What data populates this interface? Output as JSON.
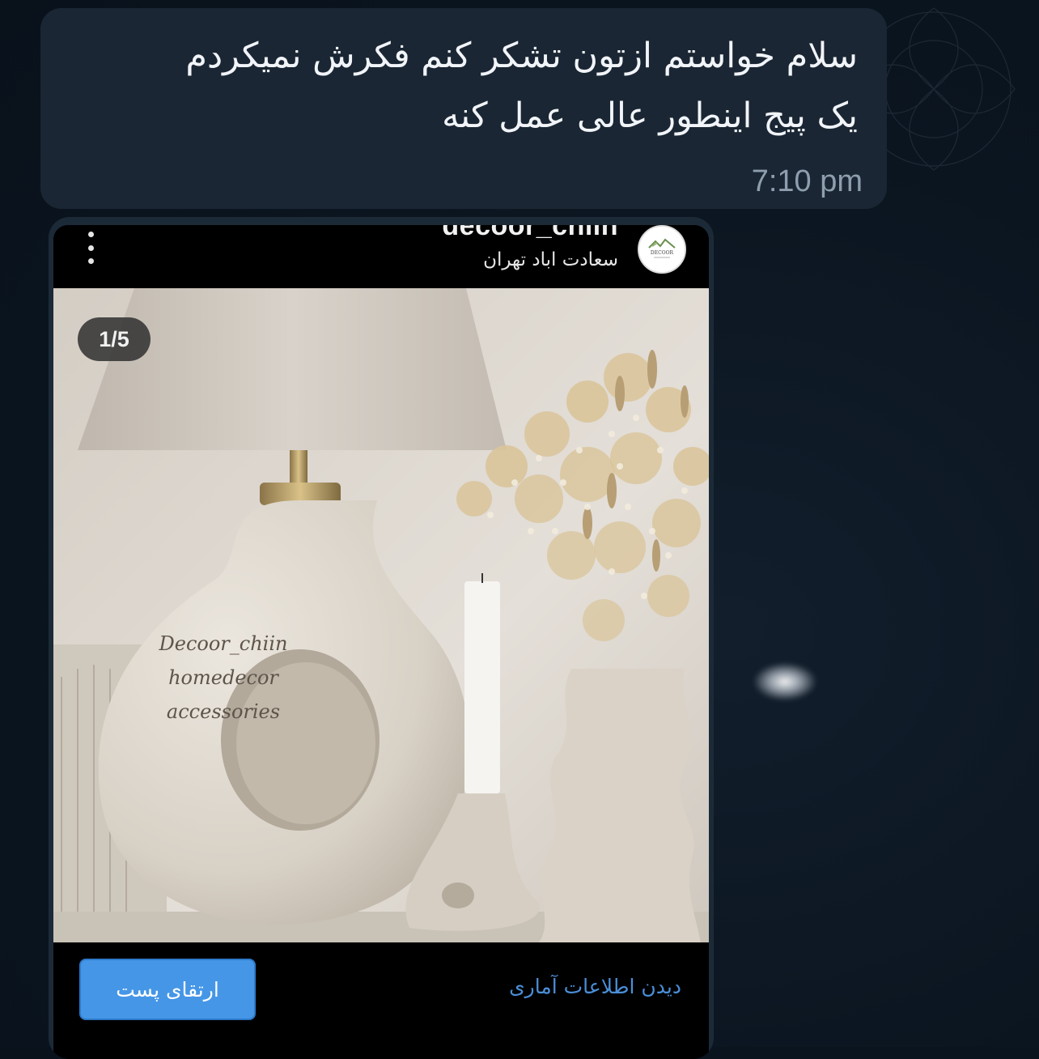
{
  "message": {
    "lines": [
      "سلام خواستم ازتون تشکر کنم فکرش نمیکردم",
      "یک پیج اینطور عالی عمل کنه"
    ],
    "time": "7:10 pm"
  },
  "post": {
    "username": "decoor_chiin",
    "location": "سعادت اباد تهران",
    "avatar_text": "DECOOR",
    "page_indicator": "1/5",
    "watermark": [
      "Decoor_chiin",
      "homedecor",
      "accessories"
    ],
    "promote_label": "ارتقای پست",
    "insights_label": "دیدن اطلاعات آماری"
  },
  "colors": {
    "background": "#0b1520",
    "bubble": "#1a2633",
    "time_text": "#8e9eae",
    "promote_button": "#4596e6",
    "insights_link": "#4b8fd9"
  },
  "icons": {
    "menu": "kebab-vertical-icon"
  }
}
